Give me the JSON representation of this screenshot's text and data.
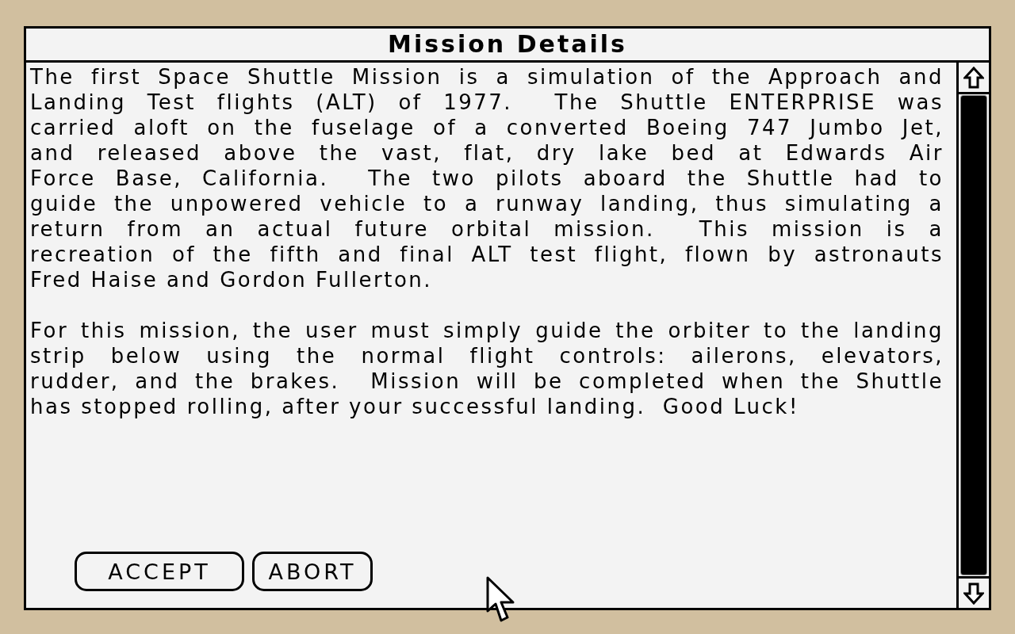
{
  "window": {
    "title": "Mission Details"
  },
  "description": {
    "paragraphs": [
      {
        "lines": [
          "The first Space Shuttle Mission is a simulation of the Approach and",
          "Landing Test flights (ALT) of 1977.  The Shuttle ENTERPRISE was",
          "carried aloft on the fuselage of a converted Boeing 747 Jumbo Jet,",
          "and released above the vast, flat, dry lake bed at Edwards Air",
          "Force Base, California.  The two pilots aboard the Shuttle had to",
          "guide the unpowered vehicle to a runway landing, thus simulating a",
          "return from an actual future orbital mission.  This mission is a",
          "recreation of the fifth and final ALT test flight, flown by astronauts",
          "Fred Haise and Gordon Fullerton."
        ]
      },
      {
        "lines": [
          "For this mission, the user must simply guide the orbiter to the landing",
          "strip below using the normal flight controls: ailerons, elevators,",
          "rudder, and the brakes.  Mission will be completed when the Shuttle",
          "has stopped rolling, after your successful landing.  Good Luck!"
        ]
      }
    ]
  },
  "buttons": [
    {
      "label": "ACCEPT"
    },
    {
      "label": "ABORT"
    }
  ]
}
